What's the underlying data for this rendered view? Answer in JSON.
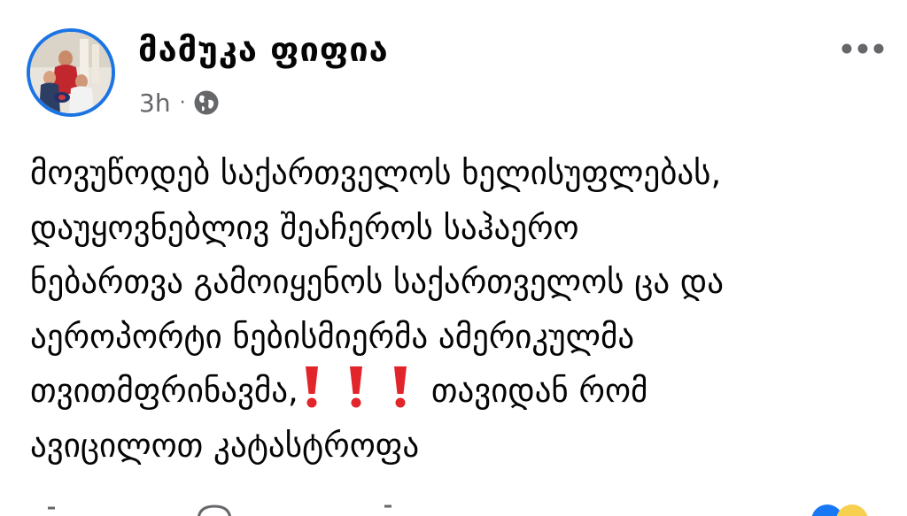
{
  "post": {
    "author": "მამუკა ფიფია",
    "time": "3h",
    "separator": "·",
    "privacy_icon": "globe-icon",
    "more_icon": "more-dots-icon",
    "body": {
      "line1": "მოვუწოდებ საქართველოს ხელისუფლებას,",
      "line2": "დაუყოვნებლივ შეაჩეროს საჰაერო",
      "line3": "ნებართვა გამოიყენოს საქართველოს ცა და",
      "line4": "აეროპორტი ნებისმიერმა ამერიკულმა",
      "line5_before": "თვითმფრინავმა,",
      "line5_after": "თავიდან რომ",
      "line6": "ავიცილოთ კატასტროფა"
    },
    "emphasis_icons": [
      "exclamation-icon",
      "exclamation-icon",
      "exclamation-icon"
    ]
  },
  "colors": {
    "text": "#050505",
    "meta": "#65676b",
    "avatar_ring": "#1b74e4",
    "exclamation": "#e2242b"
  }
}
